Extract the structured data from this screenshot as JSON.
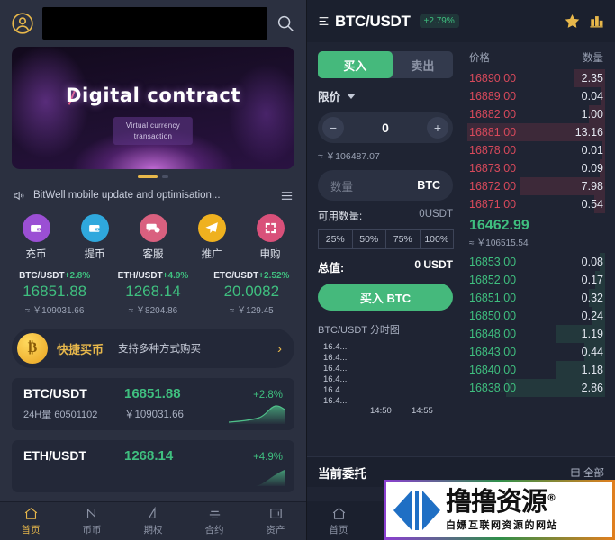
{
  "left": {
    "header": {
      "avatar_icon": "user-circle-icon",
      "search_placeholder": "",
      "search_value": "",
      "search_icon": "search-icon"
    },
    "banner": {
      "title": "Digital contract",
      "subtitle_line1": "Virtual currency",
      "subtitle_line2": "transaction"
    },
    "notice": {
      "icon": "megaphone-icon",
      "text": "BitWell mobile update and optimisation...",
      "menu_icon": "list-menu-icon"
    },
    "quick_actions": [
      {
        "label": "充币",
        "icon": "wallet-deposit-icon",
        "color": "#9b4fd4"
      },
      {
        "label": "提币",
        "icon": "wallet-withdraw-icon",
        "color": "#2fa8dd"
      },
      {
        "label": "客服",
        "icon": "chat-support-icon",
        "color": "#d9607f"
      },
      {
        "label": "推广",
        "icon": "paper-plane-icon",
        "color": "#efb11f"
      },
      {
        "label": "申购",
        "icon": "refresh-subscribe-icon",
        "color": "#d9507a"
      }
    ],
    "tickers": [
      {
        "pair": "BTC/USDT",
        "change": "+2.8%",
        "price": "16851.88",
        "cny": "≈ ￥109031.66"
      },
      {
        "pair": "ETH/USDT",
        "change": "+4.9%",
        "price": "1268.14",
        "cny": "≈ ￥8204.86"
      },
      {
        "pair": "ETC/USDT",
        "change": "+2.52%",
        "price": "20.0082",
        "cny": "≈ ￥129.45"
      }
    ],
    "promo": {
      "coin_glyph": "₿",
      "main": "快捷买币",
      "sub": "支持多种方式购买",
      "arrow": "›"
    },
    "market_cards": [
      {
        "pair": "BTC/USDT",
        "price": "16851.88",
        "change": "+2.8%",
        "volume": "24H量 60501102",
        "cny": "￥109031.66"
      },
      {
        "pair": "ETH/USDT",
        "price": "1268.14",
        "change": "+4.9%",
        "volume": "",
        "cny": ""
      }
    ],
    "nav": [
      {
        "label": "首页",
        "icon": "home-icon",
        "active": true
      },
      {
        "label": "币币",
        "icon": "exchange-icon",
        "active": false
      },
      {
        "label": "期权",
        "icon": "options-icon",
        "active": false
      },
      {
        "label": "合约",
        "icon": "contract-icon",
        "active": false
      },
      {
        "label": "资产",
        "icon": "assets-icon",
        "active": false
      }
    ]
  },
  "right": {
    "header": {
      "menu_icon": "hamburger-icon",
      "pair": "BTC/USDT",
      "change": "+2.79%",
      "star_icon": "star-favorite-icon",
      "kline_icon": "kline-chart-icon"
    },
    "form": {
      "buy_tab": "买入",
      "sell_tab": "卖出",
      "order_type": "限价",
      "minus": "−",
      "plus": "+",
      "price_value": "0",
      "price_cny": "≈ ￥106487.07",
      "amount_placeholder": "数量",
      "amount_unit": "BTC",
      "available_label": "可用数量:",
      "available_value": "0USDT",
      "percents": [
        "25%",
        "50%",
        "75%",
        "100%"
      ],
      "total_label": "总值:",
      "total_value": "0 USDT",
      "submit_label": "买入 BTC"
    },
    "chart": {
      "title": "BTC/USDT 分时图",
      "y_labels": [
        "16.4...",
        "16.4...",
        "16.4...",
        "16.4...",
        "16.4...",
        "16.4..."
      ],
      "x_labels": [
        "14:50",
        "14:55"
      ]
    },
    "book": {
      "head_price": "价格",
      "head_qty": "数量",
      "asks": [
        {
          "price": "16890.00",
          "qty": "2.35",
          "depth": 22
        },
        {
          "price": "16889.00",
          "qty": "0.04",
          "depth": 3
        },
        {
          "price": "16882.00",
          "qty": "1.00",
          "depth": 12
        },
        {
          "price": "16881.00",
          "qty": "13.16",
          "depth": 100
        },
        {
          "price": "16878.00",
          "qty": "0.01",
          "depth": 2
        },
        {
          "price": "16873.00",
          "qty": "0.09",
          "depth": 4
        },
        {
          "price": "16872.00",
          "qty": "7.98",
          "depth": 62
        },
        {
          "price": "16871.00",
          "qty": "0.54",
          "depth": 8
        }
      ],
      "last_price": "16462.99",
      "last_cny": "≈ ￥106515.54",
      "bids": [
        {
          "price": "16853.00",
          "qty": "0.08",
          "depth": 4
        },
        {
          "price": "16852.00",
          "qty": "0.17",
          "depth": 7
        },
        {
          "price": "16851.00",
          "qty": "0.32",
          "depth": 12
        },
        {
          "price": "16850.00",
          "qty": "0.24",
          "depth": 9
        },
        {
          "price": "16848.00",
          "qty": "1.19",
          "depth": 36
        },
        {
          "price": "16843.00",
          "qty": "0.44",
          "depth": 15
        },
        {
          "price": "16840.00",
          "qty": "1.18",
          "depth": 35
        },
        {
          "price": "16838.00",
          "qty": "2.86",
          "depth": 72
        }
      ]
    },
    "orders": {
      "title": "当前委托",
      "filter_icon": "filter-list-icon",
      "filter_label": "全部"
    },
    "nav": [
      {
        "label": "首页",
        "icon": "home-icon",
        "active": false
      }
    ]
  },
  "watermark": {
    "main": "撸撸资源",
    "registered": "®",
    "sub": "白嫖互联网资源的网站",
    "mark_icon": "arrow-logo-icon"
  },
  "colors": {
    "up_green": "#3fbf7f",
    "down_red": "#d8495b",
    "accent_gold": "#e8b84b",
    "panel_bg": "#2b3040",
    "right_bg": "#1f2433"
  }
}
